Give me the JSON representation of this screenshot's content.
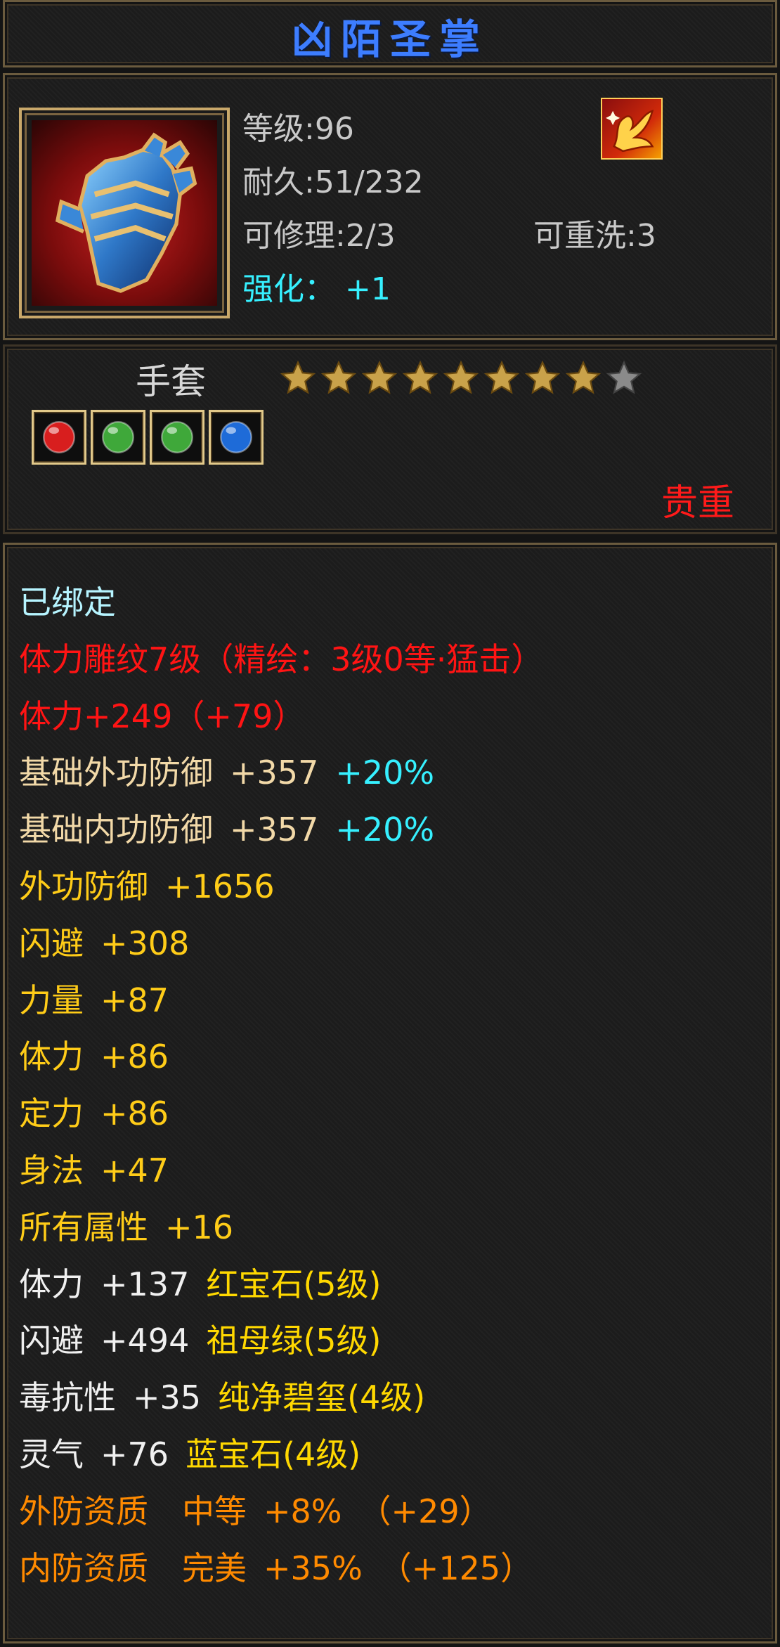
{
  "item": {
    "name": "凶陌圣掌",
    "level_label": "等级",
    "level": "96",
    "durability_label": "耐久",
    "durability": "51/232",
    "repair_label": "可修理",
    "repair": "2/3",
    "rewash_label": "可重洗",
    "rewash": "3",
    "enhance_label": "强化",
    "enhance": "+1",
    "sep": ":",
    "enhance_sep": "："
  },
  "badge_icon": "fire-phoenix-icon",
  "type_label": "手套",
  "stars": {
    "filled": 8,
    "total": 9,
    "filled_color": "#c9a24a",
    "empty_color": "#8a8a8a"
  },
  "gems": [
    {
      "icon": "ruby-gem-icon",
      "color": "#d81e1e"
    },
    {
      "icon": "emerald-gem-icon",
      "color": "#3fa83a"
    },
    {
      "icon": "emerald-gem-icon",
      "color": "#3fa83a"
    },
    {
      "icon": "sapphire-gem-icon",
      "color": "#1e6bd8"
    }
  ],
  "rarity": "贵重",
  "bound": "已绑定",
  "engrave": "体力雕纹7级（精绘：3级0等·猛击）",
  "engrave_stat": "体力+249（+79）",
  "base_def": [
    {
      "label": "基础外功防御",
      "value": "+357",
      "bonus": "+20%"
    },
    {
      "label": "基础内功防御",
      "value": "+357",
      "bonus": "+20%"
    }
  ],
  "stats": [
    {
      "label": "外功防御",
      "value": "+1656"
    },
    {
      "label": "闪避",
      "value": "+308"
    },
    {
      "label": "力量",
      "value": "+87"
    },
    {
      "label": "体力",
      "value": "+86"
    },
    {
      "label": "定力",
      "value": "+86"
    },
    {
      "label": "身法",
      "value": "+47"
    },
    {
      "label": "所有属性",
      "value": "+16"
    }
  ],
  "gem_stats": [
    {
      "label": "体力",
      "value": "+137",
      "gem": "红宝石(5级)"
    },
    {
      "label": "闪避",
      "value": "+494",
      "gem": "祖母绿(5级)"
    },
    {
      "label": "毒抗性",
      "value": "+35",
      "gem": "纯净碧玺(4级)"
    },
    {
      "label": "灵气",
      "value": "+76",
      "gem": "蓝宝石(4级)"
    }
  ],
  "qualities": [
    {
      "label": "外防资质",
      "grade": "中等",
      "value": "+8%",
      "extra": "（+29）"
    },
    {
      "label": "内防资质",
      "grade": "完美",
      "value": "+35%",
      "extra": "（+125）"
    }
  ],
  "colors": {
    "name": "#3d7dff",
    "bound": "#b6f4ff",
    "engrave": "#ff1414",
    "base_def": "#f2d9a8",
    "stat": "#ffcc18",
    "gem_label": "#f0f0f0",
    "gem_name": "#ffd800",
    "quality": "#ff8a00",
    "bonus": "#36f0ff",
    "rarity": "#ff1a1a"
  }
}
